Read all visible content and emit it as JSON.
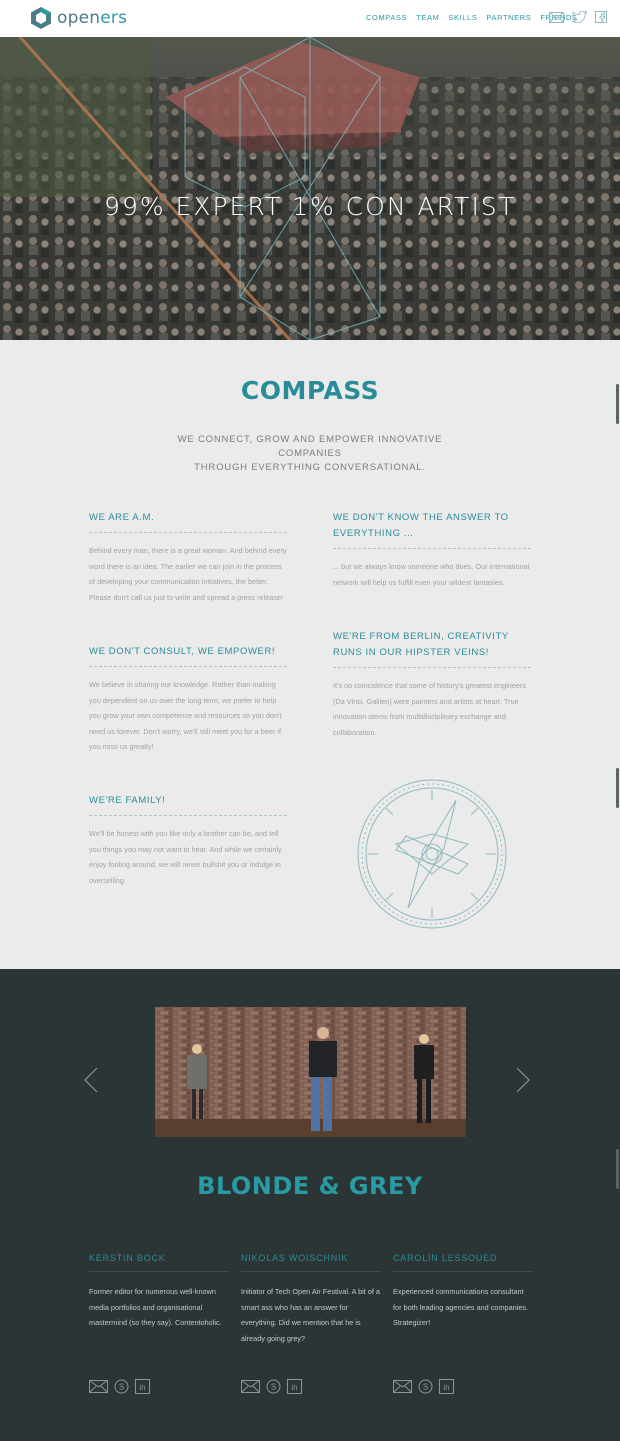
{
  "header": {
    "logo_text_a": "open",
    "logo_text_b": "ers",
    "nav": [
      "COMPASS",
      "TEAM",
      "SKILLS",
      "PARTNERS",
      "FRIENDS"
    ],
    "social_icons": [
      "mail-icon",
      "twitter-icon",
      "facebook-icon"
    ]
  },
  "hero": {
    "title": "99% EXPERT 1% CON ARTIST"
  },
  "compass": {
    "title": "COMPASS",
    "subtitle_line1": "WE CONNECT, GROW AND EMPOWER INNOVATIVE COMPANIES",
    "subtitle_line2": "THROUGH EVERYTHING CONVERSATIONAL.",
    "blocks": [
      {
        "title": "WE ARE A.M.",
        "text": "Behind every man, there is a great woman. And behind every word there is an idea. The earlier we can join in the process of developing your communication initiatives, the better. Please don't call us just to write and spread a press release!"
      },
      {
        "title": "WE DON'T KNOW THE ANSWER TO EVERYTHING ...",
        "text": "... but we always know someone who does. Our international network will help us fulfill even your wildest fantasies."
      },
      {
        "title": "WE DON'T CONSULT, WE EMPOWER!",
        "text": "We believe in sharing our knowledge. Rather than making you dependent on us over the long term, we prefer to help you grow your own competence and resources so you don't need us forever. Don't worry, we'll still meet you for a beer if you miss us greatly!"
      },
      {
        "title": "WE'RE FROM BERLIN, CREATIVITY RUNS IN OUR HIPSTER VEINS!",
        "text": "It's no coincidence that some of history's greatest engineers (Da Vinci, Galileo) were painters and artists at heart. True innovation stems from multidisciplinary exchange and collaboration."
      },
      {
        "title": "WE'RE FAMILY!",
        "text": "We'll be honest with you like only a brother can be, and tell you things you may not want to hear. And while we certainly enjoy fooling around, we will never bullshit you or indulge in overselling."
      }
    ]
  },
  "team": {
    "title": "BLONDE & GREY",
    "members": [
      {
        "name": "KERSTIN BOCK",
        "bio": "Former editor for numerous well-known media portfolios and organisational mastermind (so they say). Contentoholic."
      },
      {
        "name": "NIKOLAS WOISCHNIK",
        "bio": "Initiator of Tech Open Air Festival. A bit of a smart ass who has an answer for everything. Did we mention that he is already going grey?"
      },
      {
        "name": "CAROLIN LESSOUED",
        "bio": "Experienced communications consultant for both leading agencies and companies. Strategizer!"
      }
    ],
    "member_icons": [
      "mail-icon",
      "skype-icon",
      "linkedin-icon"
    ]
  },
  "colors": {
    "accent": "#2a8c98",
    "header_bg": "#ffffff",
    "compass_bg": "#ebebeb",
    "team_bg": "#2c3536"
  }
}
